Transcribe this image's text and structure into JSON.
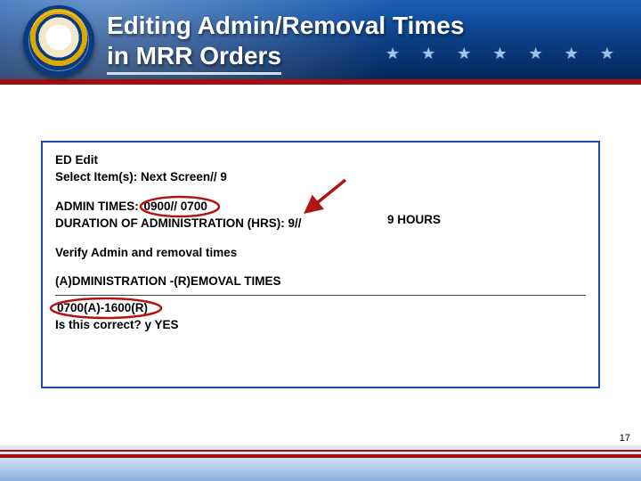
{
  "header": {
    "title_line1": "Editing Admin/Removal Times",
    "title_line2": "in MRR Orders"
  },
  "box": {
    "line_ed": "ED  Edit",
    "line_select": "Select Item(s): Next Screen// 9",
    "admin_times_label": "ADMIN TIMES:",
    "admin_times_value": "0900// 0700",
    "duration_label": "DURATION OF ADMINISTRATION (HRS): 9//",
    "duration_value": "9 HOURS",
    "verify": "Verify Admin and removal times",
    "ar_header": "(A)DMINISTRATION -(R)EMOVAL TIMES",
    "ar_value": "0700(A)-1600(R)",
    "confirm": "Is this correct? y  YES"
  },
  "page_number": "17",
  "colors": {
    "circle": "#b01414",
    "arrow": "#b01414",
    "border": "#1a4ea8"
  }
}
